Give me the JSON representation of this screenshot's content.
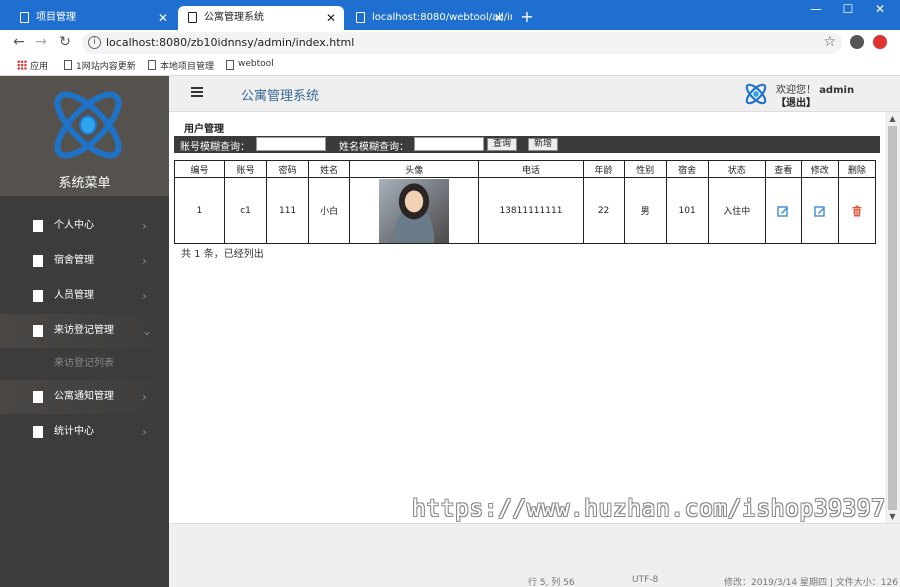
{
  "browser": {
    "tabs": [
      {
        "title": "项目管理"
      },
      {
        "title": "公寓管理系统"
      },
      {
        "title": "localhost:8080/webtool/all/in"
      }
    ],
    "url": "localhost:8080/zb10idnnsy/admin/index.html",
    "bookmarks": [
      "应用",
      "1网站内容更新",
      "本地项目管理",
      "webtool"
    ]
  },
  "sidebar": {
    "title": "系统菜单",
    "items": [
      {
        "label": "个人中心"
      },
      {
        "label": "宿舍管理"
      },
      {
        "label": "人员管理"
      },
      {
        "label": "来访登记管理"
      },
      {
        "label": "公寓通知管理"
      },
      {
        "label": "统计中心"
      }
    ],
    "subitem": "来访登记列表"
  },
  "header": {
    "title": "公寓管理系统",
    "welcome": "欢迎您！",
    "user": "admin",
    "logout": "【退出】"
  },
  "content": {
    "section_title": "用户管理",
    "search": {
      "account_label": "账号模糊查询：",
      "name_label": "姓名模糊查询：",
      "search_btn": "查询",
      "add_btn": "新增"
    },
    "columns": [
      "编号",
      "账号",
      "密码",
      "姓名",
      "头像",
      "电话",
      "年龄",
      "性别",
      "宿舍",
      "状态",
      "查看",
      "修改",
      "删除"
    ],
    "rows": [
      {
        "id": "1",
        "account": "c1",
        "password": "111",
        "name": "小白",
        "phone": "13811111111",
        "age": "22",
        "gender": "男",
        "dorm": "101",
        "status": "入住中"
      }
    ],
    "summary": "共 1 条，已经列出"
  },
  "watermark": "https://www.huzhan.com/ishop39397",
  "bottom_text": [
    "行 5, 列 56",
    "UTF-8",
    "修改：2019/3/14 星期四 | 文件大小：126"
  ],
  "colors": {
    "tabbar": "#1f6fd0",
    "sidebar": "#3e3c3a",
    "title_blue": "#3a6a95",
    "delete_red": "#e05a3a",
    "edit_blue": "#3d8bd4"
  }
}
